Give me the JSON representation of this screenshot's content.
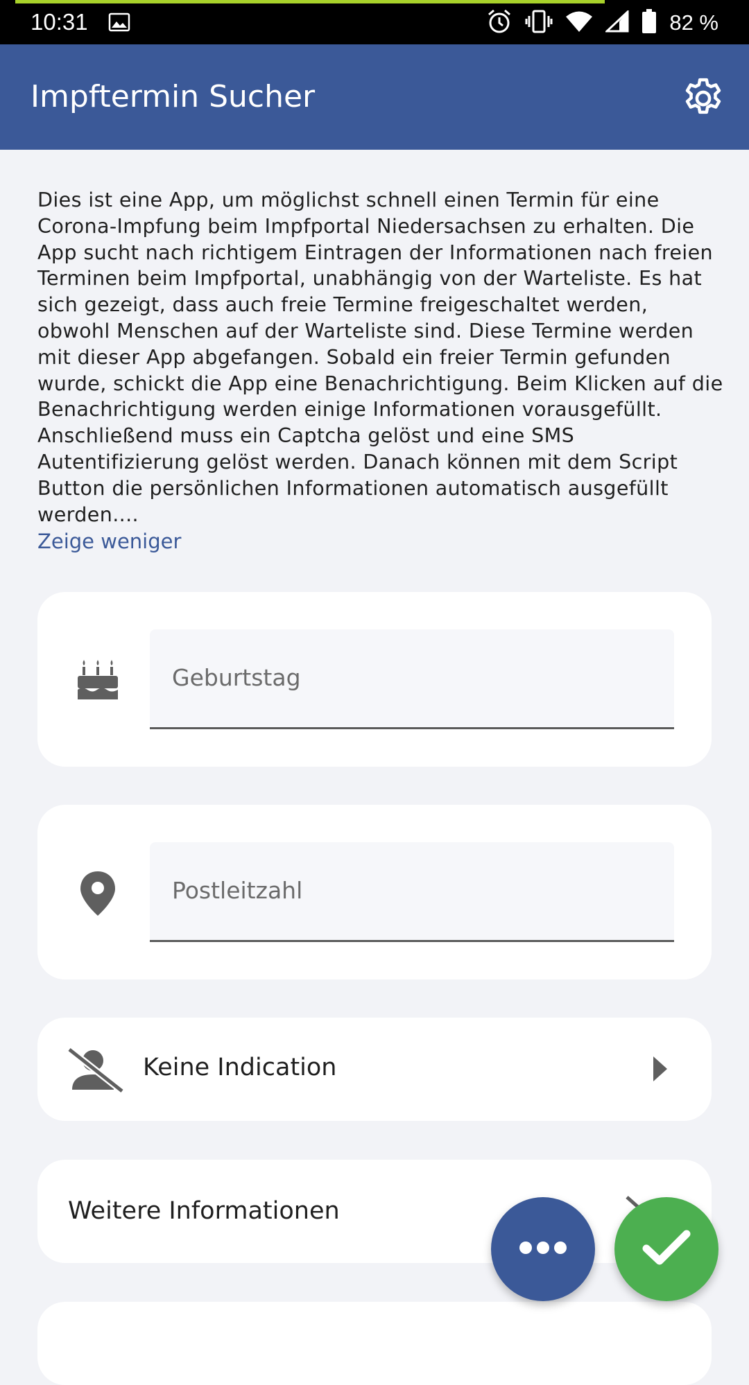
{
  "status_bar": {
    "time": "10:31",
    "battery": "82 %",
    "icons": [
      "gallery-icon",
      "alarm-icon",
      "vibrate-icon",
      "wifi-icon",
      "signal-icon",
      "battery-icon"
    ]
  },
  "app_bar": {
    "title": "Impftermin Sucher",
    "settings_icon": "gear-icon",
    "color": "#3b5998"
  },
  "description": {
    "text": "Dies ist eine App, um möglichst schnell einen Termin für eine Corona-Impfung beim Impfportal Niedersachsen zu erhalten. Die App sucht nach richtigem Eintragen der Informationen nach freien Terminen beim Impfportal, unabhängig von der Warteliste. Es hat sich gezeigt, dass auch freie Termine freigeschaltet werden, obwohl Menschen auf der Warteliste sind. Diese Termine werden mit dieser App abgefangen. Sobald ein freier Termin gefunden wurde, schickt die App eine Benachrichtigung. Beim Klicken auf die Benachrichtigung werden einige Informationen vorausgefüllt. Anschließend muss ein Captcha gelöst und eine SMS Autentifizierung gelöst werden. Danach können mit dem Script Button die persönlichen Informationen automatisch ausgefüllt werden....",
    "toggle_label": "Zeige weniger"
  },
  "form": {
    "birthday": {
      "placeholder": "Geburtstag",
      "value": "",
      "icon": "cake-icon"
    },
    "zip": {
      "placeholder": "Postleitzahl",
      "value": "",
      "icon": "location-pin-icon"
    },
    "indication": {
      "label": "Keine Indication",
      "icon": "person-off-icon",
      "arrow_icon": "arrow-right-icon"
    },
    "more_info": {
      "label": "Weitere Informationen",
      "icon": "chevron-icon"
    }
  },
  "fabs": {
    "more": {
      "icon": "more-horizontal-icon",
      "color": "#3b5998"
    },
    "confirm": {
      "icon": "check-icon",
      "color": "#4caf50"
    }
  }
}
